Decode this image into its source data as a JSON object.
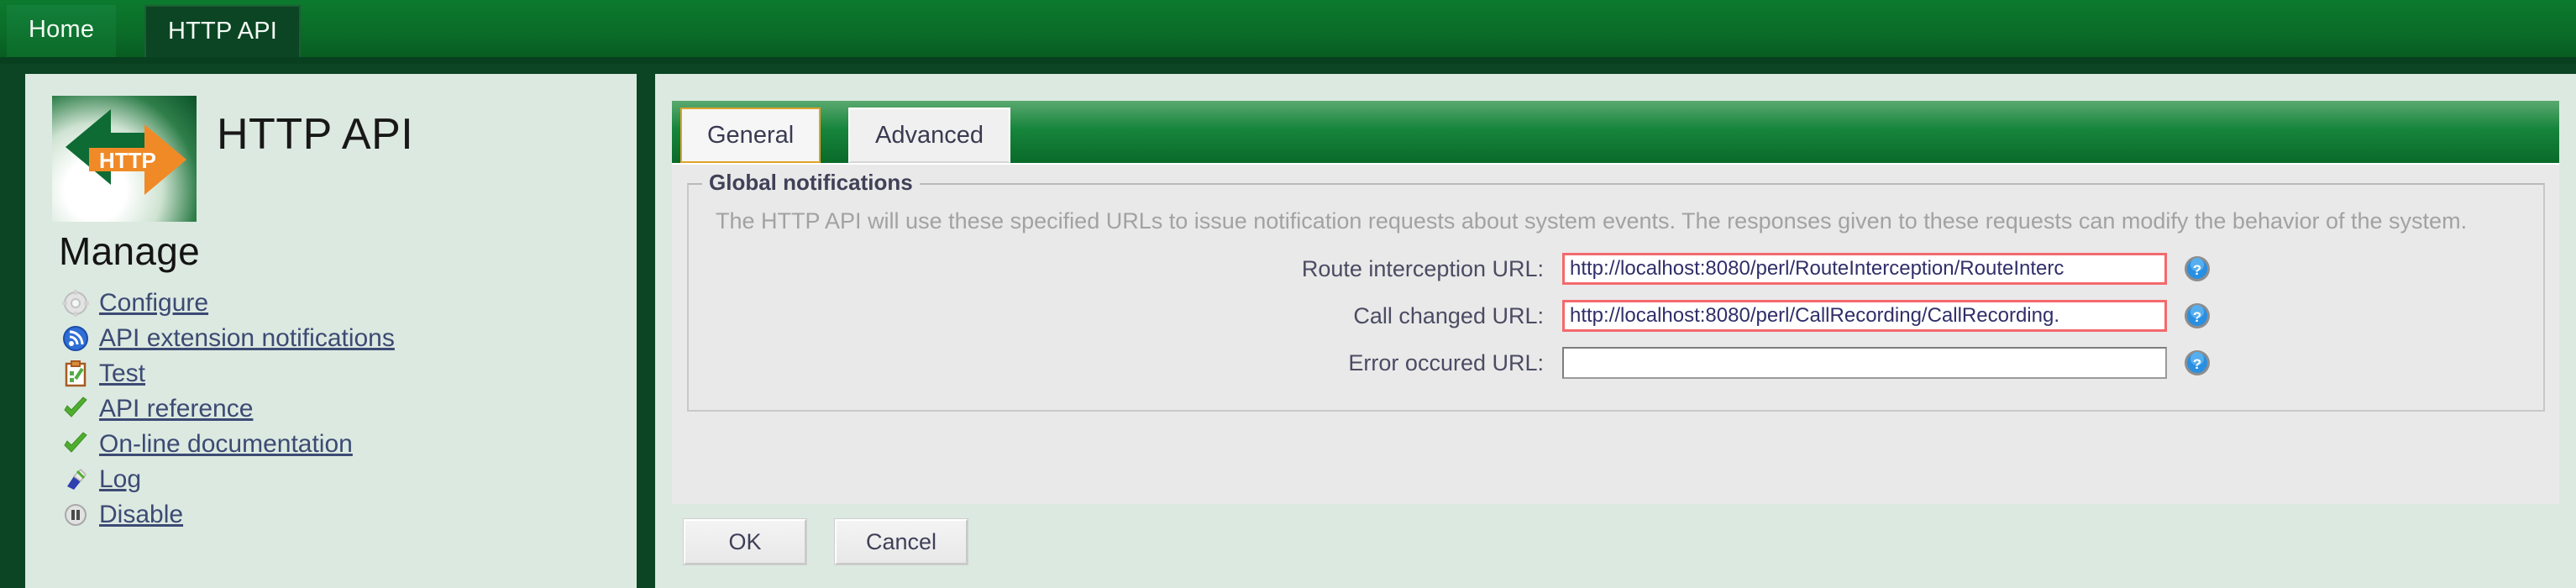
{
  "topnav": {
    "tabs": [
      {
        "label": "Home",
        "active": false
      },
      {
        "label": "HTTP API",
        "active": true
      }
    ]
  },
  "sidebar": {
    "app_title": "HTTP API",
    "logo_text": "HTTP",
    "section_heading": "Manage",
    "items": [
      {
        "label": "Configure",
        "icon": "gear-icon"
      },
      {
        "label": "API extension notifications",
        "icon": "rss-feed-icon"
      },
      {
        "label": "Test",
        "icon": "clipboard-test-icon"
      },
      {
        "label": "API reference",
        "icon": "green-check-icon"
      },
      {
        "label": "On-line documentation",
        "icon": "green-check-icon"
      },
      {
        "label": "Log",
        "icon": "log-pen-icon"
      },
      {
        "label": "Disable",
        "icon": "pause-icon"
      }
    ]
  },
  "content": {
    "tabs": [
      {
        "label": "General",
        "active": true
      },
      {
        "label": "Advanced",
        "active": false
      }
    ],
    "fieldset": {
      "legend": "Global notifications",
      "description": "The HTTP API will use these specified URLs to issue notification requests about system events. The responses given to these requests can modify the behavior of the system.",
      "fields": [
        {
          "label": "Route interception URL:",
          "value": "http://localhost:8080/perl/RouteInterception/RouteInterc",
          "placeholder": "",
          "invalid": true,
          "help_icon": "help-question-icon"
        },
        {
          "label": "Call changed URL:",
          "value": "http://localhost:8080/perl/CallRecording/CallRecording.",
          "placeholder": "",
          "invalid": true,
          "help_icon": "help-question-icon"
        },
        {
          "label": "Error occured URL:",
          "value": "",
          "placeholder": "",
          "invalid": false,
          "help_icon": "help-question-icon"
        }
      ]
    },
    "buttons": {
      "ok_label": "OK",
      "cancel_label": "Cancel"
    }
  },
  "colors": {
    "brand_green": "#0a6b27",
    "dark_green": "#0b4524",
    "panel_bg": "#dce9e0",
    "form_bg": "#e9e9e9",
    "selected_tab_border": "#e0a22b",
    "error_border": "#f4696c",
    "link_text": "#3c4a74",
    "accent_orange": "#f08a26"
  }
}
